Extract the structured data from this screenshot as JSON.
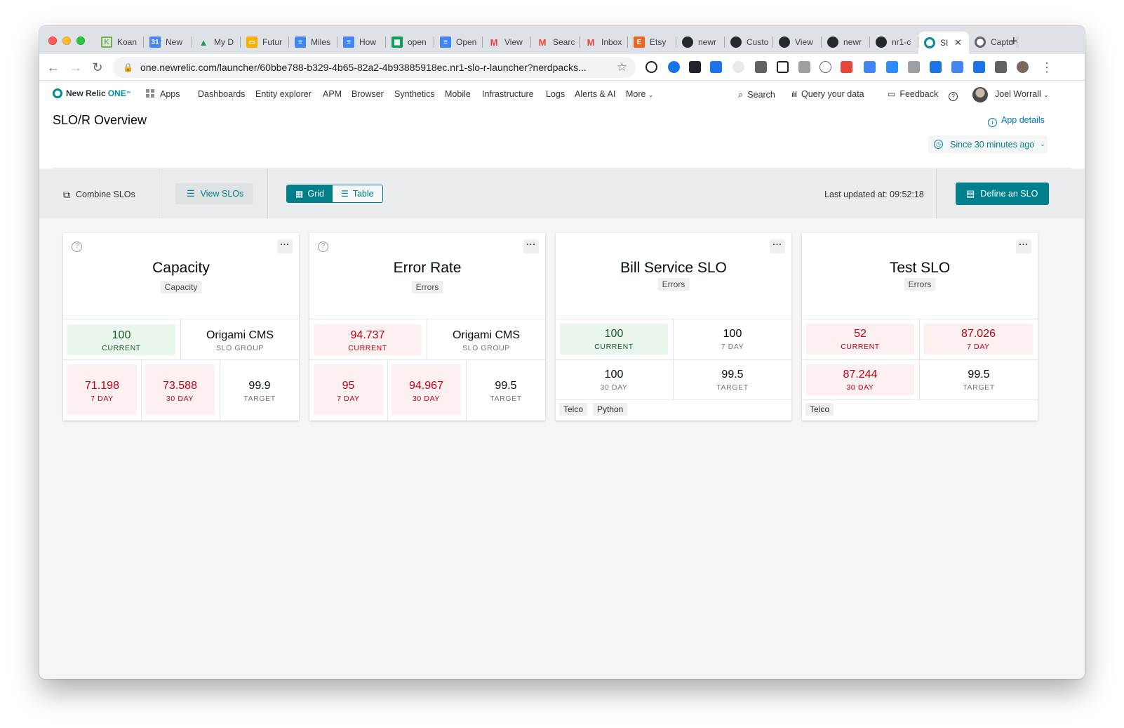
{
  "browser": {
    "tabs": [
      {
        "title": "Koan",
        "icon": "koan-icon",
        "color": "#6fb44a"
      },
      {
        "title": "New",
        "icon": "calendar-icon",
        "color": "#4285f4"
      },
      {
        "title": "My D",
        "icon": "drive-icon",
        "color": "#f4b400"
      },
      {
        "title": "Futur",
        "icon": "slides-icon",
        "color": "#f6b000"
      },
      {
        "title": "Miles",
        "icon": "docs-icon",
        "color": "#4285f4"
      },
      {
        "title": "How",
        "icon": "docs-icon",
        "color": "#4285f4"
      },
      {
        "title": "open",
        "icon": "sheets-icon",
        "color": "#0f9d58"
      },
      {
        "title": "Open",
        "icon": "docs-icon",
        "color": "#4285f4"
      },
      {
        "title": "View",
        "icon": "gmail-icon",
        "color": "#ea4335"
      },
      {
        "title": "Searc",
        "icon": "gmail-icon",
        "color": "#ea4335"
      },
      {
        "title": "Inbox",
        "icon": "gmail-icon",
        "color": "#ea4335"
      },
      {
        "title": "Etsy",
        "icon": "etsy-icon",
        "color": "#f1641e"
      },
      {
        "title": "newr",
        "icon": "github-icon",
        "color": "#24292e"
      },
      {
        "title": "Custo",
        "icon": "github-icon",
        "color": "#24292e"
      },
      {
        "title": "View",
        "icon": "github-icon",
        "color": "#24292e"
      },
      {
        "title": "newr",
        "icon": "github-icon",
        "color": "#24292e"
      },
      {
        "title": "nr1-c",
        "icon": "github-icon",
        "color": "#24292e"
      },
      {
        "title": "SI",
        "icon": "newrelic-icon",
        "color": "#008c99",
        "active": true
      },
      {
        "title": "Captu",
        "icon": "globe-icon",
        "color": "#5f6368"
      }
    ],
    "url": "one.newrelic.com/launcher/60bbe788-b329-4b65-82a2-4b93885918ec.nr1-slo-r-launcher?nerdpacks..."
  },
  "nav": {
    "logo_text": "New Relic",
    "logo_one": "ONE",
    "logo_tm": "™",
    "apps": "Apps",
    "items": [
      "Dashboards",
      "Entity explorer",
      "APM",
      "Browser",
      "Synthetics",
      "Mobile",
      "Infrastructure",
      "Logs",
      "Alerts & AI",
      "More"
    ],
    "search": "Search",
    "query": "Query your data",
    "feedback": "Feedback",
    "user": "Joel Worrall"
  },
  "page": {
    "title": "SLO/R Overview",
    "app_details": "App details",
    "time_range": "Since 30 minutes ago"
  },
  "controls": {
    "combine": "Combine SLOs",
    "view": "View SLOs",
    "grid": "Grid",
    "table": "Table",
    "last_updated": "Last updated at: 09:52:18",
    "define": "Define an SLO"
  },
  "cards": [
    {
      "name": "Capacity",
      "tag": "Capacity",
      "current": {
        "value": "100",
        "label": "CURRENT",
        "status": "green"
      },
      "group": {
        "value": "Origami CMS",
        "label": "SLO GROUP"
      },
      "seven_day": {
        "value": "71.198",
        "label": "7 DAY",
        "status": "red"
      },
      "thirty_day": {
        "value": "73.588",
        "label": "30 DAY",
        "status": "red"
      },
      "target": {
        "value": "99.9",
        "label": "TARGET"
      }
    },
    {
      "name": "Error Rate",
      "tag": "Errors",
      "current": {
        "value": "94.737",
        "label": "CURRENT",
        "status": "red"
      },
      "group": {
        "value": "Origami CMS",
        "label": "SLO GROUP"
      },
      "seven_day": {
        "value": "95",
        "label": "7 DAY",
        "status": "red"
      },
      "thirty_day": {
        "value": "94.967",
        "label": "30 DAY",
        "status": "red"
      },
      "target": {
        "value": "99.5",
        "label": "TARGET"
      }
    },
    {
      "name": "Bill Service SLO",
      "tag": "Errors",
      "current": {
        "value": "100",
        "label": "CURRENT",
        "status": "green"
      },
      "seven_day": {
        "value": "100",
        "label": "7 DAY",
        "status": "plain"
      },
      "thirty_day": {
        "value": "100",
        "label": "30 DAY",
        "status": "plain"
      },
      "target": {
        "value": "99.5",
        "label": "TARGET"
      },
      "chips": [
        "Telco",
        "Python"
      ]
    },
    {
      "name": "Test SLO",
      "tag": "Errors",
      "current": {
        "value": "52",
        "label": "CURRENT",
        "status": "red"
      },
      "seven_day": {
        "value": "87.026",
        "label": "7 DAY",
        "status": "red"
      },
      "thirty_day": {
        "value": "87.244",
        "label": "30 DAY",
        "status": "red"
      },
      "target": {
        "value": "99.5",
        "label": "TARGET"
      },
      "chips": [
        "Telco"
      ]
    }
  ]
}
